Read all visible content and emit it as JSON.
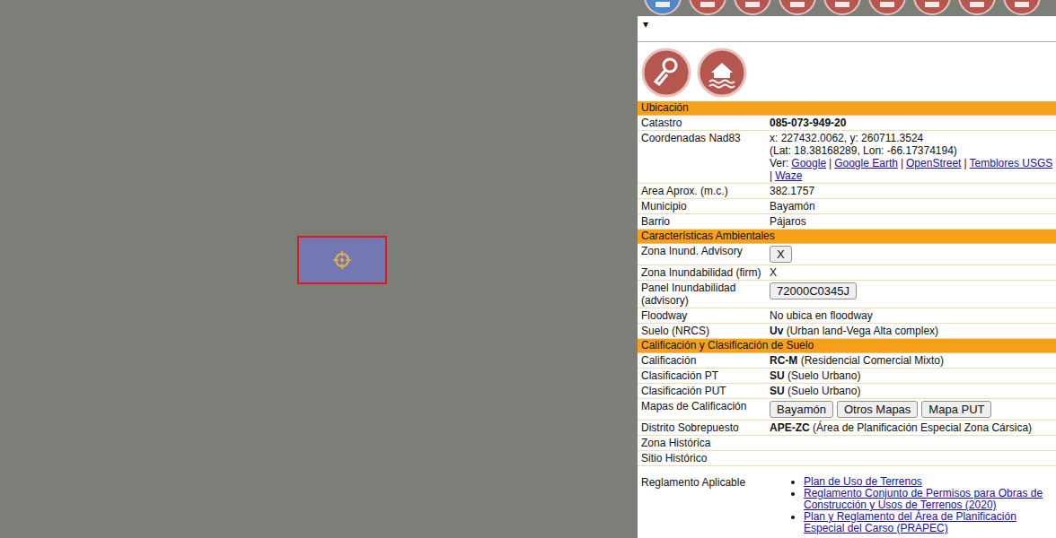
{
  "panel": {
    "menu_glyph": "▾",
    "sections": [
      {
        "title": "Ubicación",
        "rows": [
          {
            "label": "Catastro",
            "kind": "bold",
            "strong": "085-073-949-20",
            "text": ""
          },
          {
            "label": "Coordenadas Nad83",
            "kind": "coords",
            "lines": [
              "x: 227432.0062, y: 260711.3524",
              "(Lat: 18.38168289, Lon: -66.17374194)"
            ],
            "prefix": "Ver:",
            "separator": "|",
            "links": [
              "Google",
              "Google Earth",
              "OpenStreet",
              "Temblores USGS",
              "Waze"
            ]
          },
          {
            "label": "Area Aprox. (m.c.)",
            "kind": "text",
            "text": "382.1757"
          },
          {
            "label": "Municipio",
            "kind": "text",
            "text": "Bayamón"
          },
          {
            "label": "Barrio",
            "kind": "text",
            "text": "Pájaros"
          }
        ]
      },
      {
        "title": "Características Ambientales",
        "rows": [
          {
            "label": "Zona Inund. Advisory",
            "kind": "buttons",
            "buttons": [
              "X"
            ]
          },
          {
            "label": "Zona Inundabilidad (firm)",
            "kind": "text",
            "text": "X"
          },
          {
            "label": "Panel Inundabilidad (advisory)",
            "kind": "buttons",
            "buttons": [
              "72000C0345J"
            ]
          },
          {
            "label": "Floodway",
            "kind": "text",
            "text": "No ubica en floodway"
          },
          {
            "label": "Suelo (NRCS)",
            "kind": "bold",
            "strong": "Uv",
            "text": " (Urban land-Vega Alta complex)"
          }
        ]
      },
      {
        "title": "Calificación y Clasificación de Suelo",
        "rows": [
          {
            "label": "Calificación",
            "kind": "bold",
            "strong": "RC-M",
            "text": " (Residencial Comercial Mixto)"
          },
          {
            "label": "Clasificación PT",
            "kind": "bold",
            "strong": "SU",
            "text": " (Suelo Urbano)"
          },
          {
            "label": "Clasificación PUT",
            "kind": "bold",
            "strong": "SU",
            "text": " (Suelo Urbano)"
          },
          {
            "label": "Mapas de Calificación",
            "kind": "buttons",
            "buttons": [
              "Bayamón",
              "Otros Mapas",
              "Mapa PUT"
            ]
          },
          {
            "label": "Distrito Sobrepuesto",
            "kind": "bold",
            "strong": "APE-ZC",
            "text": " (Área de Planificación Especial Zona Cársica)"
          },
          {
            "label": "Zona Histórica",
            "kind": "text",
            "text": ""
          },
          {
            "label": "Sitio Histórico",
            "kind": "text",
            "text": ""
          },
          {
            "label": "Reglamento Aplicable",
            "kind": "list",
            "items": [
              "Plan de Uso de Terrenos",
              "Reglamento Conjunto de Permisos para Obras de Construcción y Usos de Terrenos (2020)",
              "Plan y Reglamento del Área de Planificación Especial del Carso (PRAPEC)"
            ]
          }
        ]
      }
    ]
  }
}
